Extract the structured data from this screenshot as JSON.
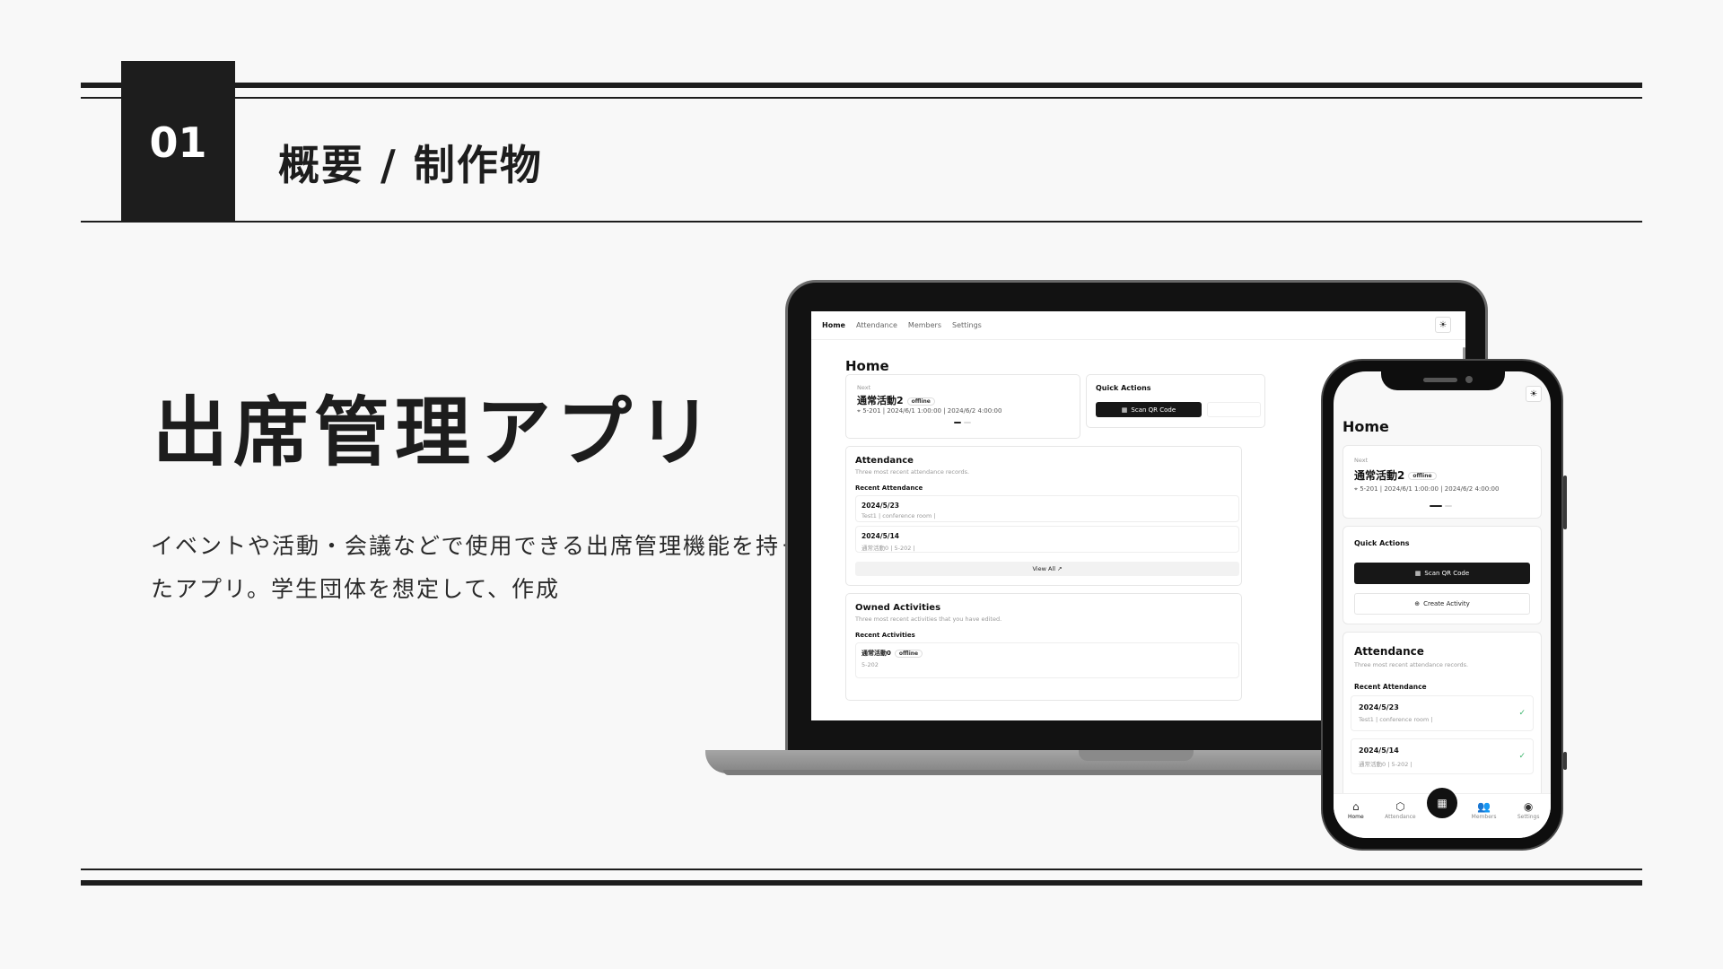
{
  "slide": {
    "number": "01",
    "section_title": "概要 / 制作物",
    "app_title": "出席管理アプリ",
    "description": "イベントや活動・会議などで使用できる出席管理機能を持ったアプリ。学生団体を想定して、作成"
  },
  "laptop": {
    "nav": [
      "Home",
      "Attendance",
      "Members",
      "Settings"
    ],
    "theme_icon": "sun-icon",
    "page_title": "Home",
    "next": {
      "label": "Next",
      "name": "通常活動2",
      "badge": "offline",
      "meta": "5-201 | 2024/6/1 1:00:00 | 2024/6/2 4:00:00"
    },
    "quick_actions": {
      "title": "Quick Actions",
      "scan": "Scan QR Code"
    },
    "attendance": {
      "title": "Attendance",
      "subtitle": "Three most recent attendance records.",
      "section": "Recent Attendance",
      "rows": [
        {
          "date": "2024/5/23",
          "meta": "Test1 | conference room |"
        },
        {
          "date": "2024/5/14",
          "meta": "通常活動0 | 5-202 |"
        }
      ],
      "view_all": "View All ↗"
    },
    "owned": {
      "title": "Owned Activities",
      "subtitle": "Three most recent activities that you have edited.",
      "section": "Recent Activities",
      "first": "通常活動0",
      "first_badge": "offline",
      "first_meta": "5-202"
    }
  },
  "phone": {
    "theme_icon": "sun-icon",
    "page_title": "Home",
    "next": {
      "label": "Next",
      "name": "通常活動2",
      "badge": "offline",
      "meta": "5-201 | 2024/6/1 1:00:00 | 2024/6/2 4:00:00"
    },
    "quick_actions": {
      "title": "Quick Actions",
      "scan": "Scan QR Code",
      "create": "Create Activity"
    },
    "attendance": {
      "title": "Attendance",
      "subtitle": "Three most recent attendance records.",
      "section": "Recent Attendance",
      "rows": [
        {
          "date": "2024/5/23",
          "meta": "Test1 | conference room |"
        },
        {
          "date": "2024/5/14",
          "meta": "通常活動0 | 5-202 |"
        }
      ]
    },
    "tabs": [
      {
        "label": "Home",
        "icon": "home-icon"
      },
      {
        "label": "Attendance",
        "icon": "box-icon"
      },
      {
        "label": "Members",
        "icon": "users-icon"
      },
      {
        "label": "Settings",
        "icon": "user-circle-icon"
      }
    ],
    "fab_icon": "qr-icon"
  },
  "colors": {
    "background": "#f8f8f8",
    "ink": "#1d1d1d",
    "accent_check": "#39b46a"
  }
}
